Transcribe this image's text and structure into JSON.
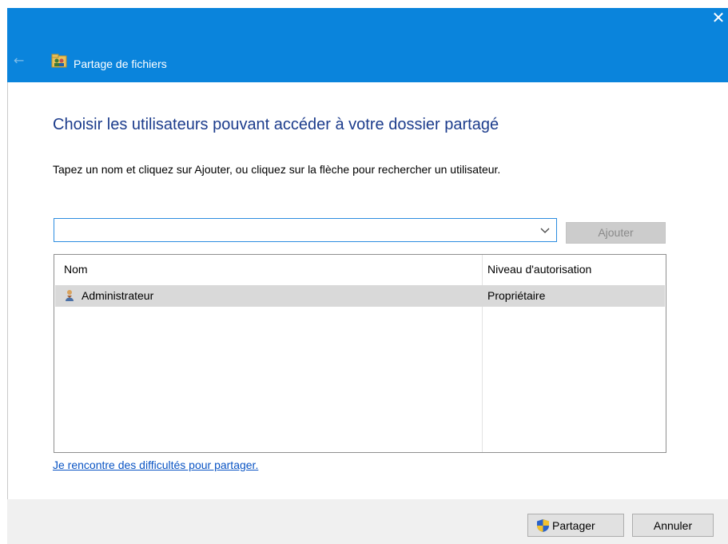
{
  "window": {
    "title": "Partage de fichiers",
    "close_glyph": "✕",
    "back_glyph": "←",
    "icon": "folder-users-icon"
  },
  "main": {
    "heading": "Choisir les utilisateurs pouvant accéder à votre dossier partagé",
    "instruction": "Tapez un nom et cliquez sur Ajouter, ou cliquez sur la flèche pour rechercher un utilisateur.",
    "name_input": {
      "value": "",
      "placeholder": ""
    },
    "add_button": {
      "label": "Ajouter",
      "enabled": false
    }
  },
  "table": {
    "columns": [
      "Nom",
      "Niveau d'autorisation"
    ],
    "rows": [
      {
        "name": "Administrateur",
        "permission": "Propriétaire",
        "icon": "user-icon",
        "selected": true
      }
    ]
  },
  "help_link": "Je rencontre des difficultés pour partager.",
  "footer": {
    "share_label": "Partager",
    "cancel_label": "Annuler"
  },
  "colors": {
    "accent": "#0a84dc",
    "heading": "#1c3c8c",
    "link": "#0a54c4"
  }
}
